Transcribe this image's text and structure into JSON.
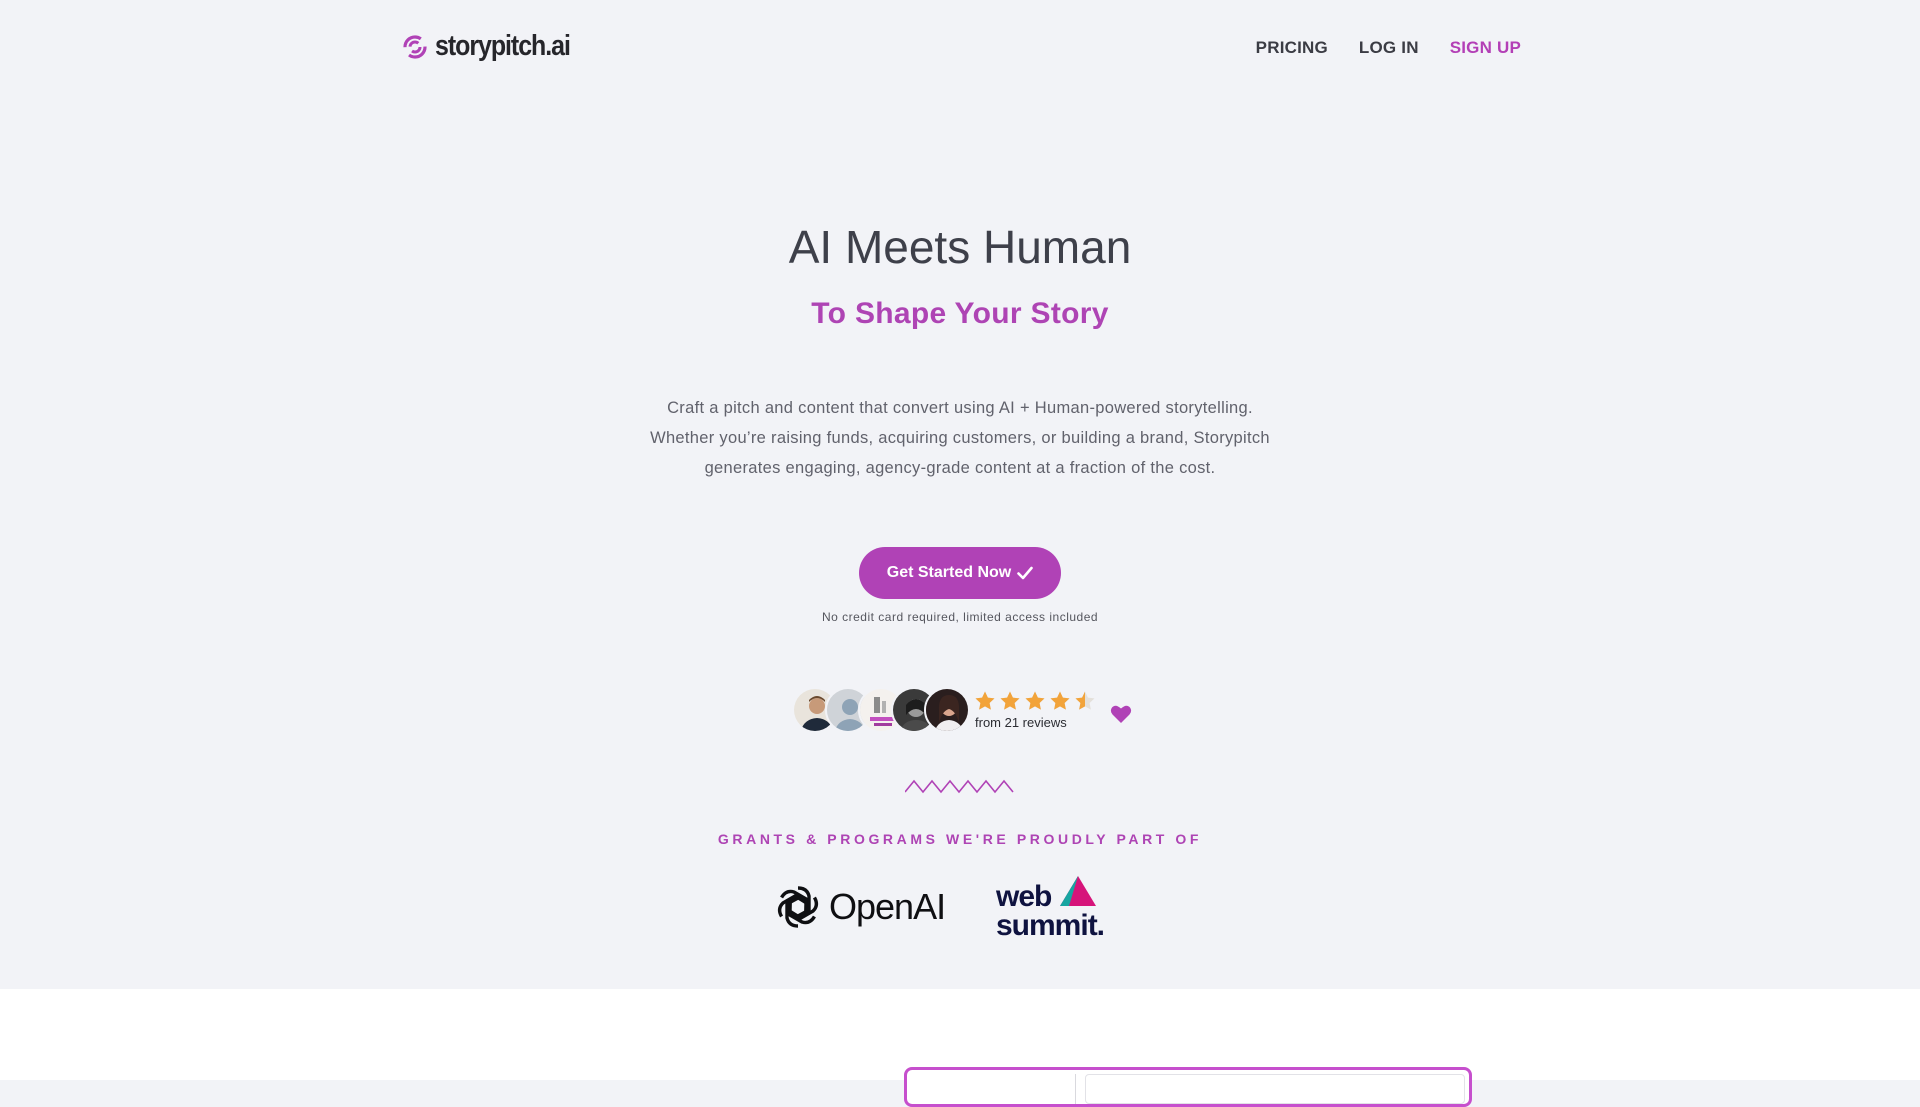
{
  "brand": {
    "name": "storypitch.ai",
    "accent_color": "#b042b6"
  },
  "nav": {
    "items": [
      {
        "label": "PRICING"
      },
      {
        "label": "LOG IN"
      },
      {
        "label": "SIGN UP"
      }
    ]
  },
  "hero": {
    "title": "AI Meets Human",
    "subtitle": "To Shape Your Story",
    "description_lines": [
      "Craft a pitch and content that convert using AI + Human-powered storytelling.",
      "Whether you’re raising funds, acquiring customers, or building a brand, Storypitch",
      "generates engaging, agency-grade content at a fraction of the cost."
    ],
    "cta_label": "Get Started Now",
    "cta_icon": "checkmark-icon",
    "cta_note": "No credit card required, limited access included"
  },
  "reviews": {
    "rating": 4.5,
    "max_rating": 5,
    "count_text": "from 21 reviews",
    "star_color": "#f2a33a",
    "heart_icon": "heart-icon"
  },
  "grants": {
    "heading": "GRANTS & PROGRAMS WE'RE PROUDLY PART OF",
    "partners": [
      {
        "name": "OpenAI"
      },
      {
        "name": "web summit."
      }
    ]
  }
}
